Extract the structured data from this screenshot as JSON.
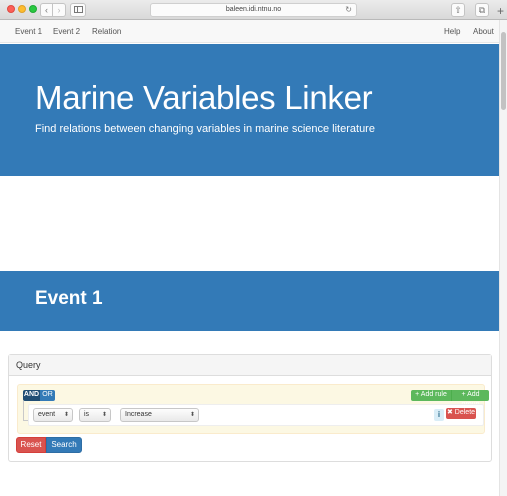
{
  "browser": {
    "url": "baleen.idi.ntnu.no",
    "back_glyph": "‹",
    "forward_glyph": "›",
    "reload_glyph": "↻",
    "share_glyph": "⇧",
    "tabs_glyph": "⧉",
    "new_tab_glyph": "+"
  },
  "nav": {
    "left": [
      "Event 1",
      "Event 2",
      "Relation"
    ],
    "right": [
      "Help",
      "About"
    ]
  },
  "hero": {
    "title": "Marine Variables Linker",
    "subtitle": "Find relations between changing variables in marine science literature"
  },
  "section": {
    "title": "Event 1"
  },
  "query": {
    "panel_title": "Query",
    "and_label": "AND",
    "or_label": "OR",
    "add_rule_label": "Add rule",
    "add_group_label": "Add group",
    "add_icon": "+",
    "rule": {
      "field": "event",
      "operator": "is",
      "value": "Increase",
      "caret_glyph": "⬍",
      "info_glyph": "i",
      "delete_label": "Delete",
      "delete_icon": "✖"
    },
    "reset_label": "Reset",
    "search_label": "Search"
  },
  "colors": {
    "primary": "#337ab7",
    "success": "#5cb85c",
    "danger": "#d9534f",
    "group_bg": "#fcf8e3"
  }
}
